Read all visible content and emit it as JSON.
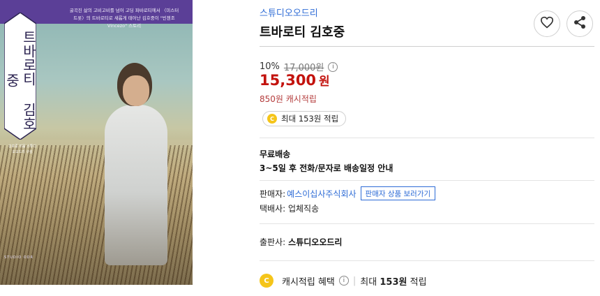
{
  "cover": {
    "title": "트바로티 김호중",
    "blurb": "굴곡진 삶의 고비고비를 넘어 고딩 파바로티에서 〈미스터트롯〉의 트바로티로 새롭게 태어난 김호중이 \"빈첸조Vincezo\" 스토리",
    "credits": "김호중 지음 스튜디오오드리 구성",
    "publisher_mark": "STUDIO ODR"
  },
  "product": {
    "brand": "스튜디오오드리",
    "title": "트바로티 김호중"
  },
  "actions": {
    "like_icon": "heart-icon",
    "share_icon": "share-icon"
  },
  "price": {
    "discount": "10%",
    "original": "17,000원",
    "sale_amount": "15,300",
    "sale_unit": "원",
    "cash_earn": "850원 캐시적립",
    "earn_badge": "최대 153원 적립",
    "coin_letter": "C"
  },
  "shipping": {
    "title": "무료배송",
    "desc": "3~5일 후 전화/문자로 배송일정 안내"
  },
  "seller": {
    "label": "판매자:",
    "name": "예스이십사주식회사",
    "button": "판매자 상품 보러가기",
    "courier": "택배사: 업체직송"
  },
  "publisher": {
    "label": "출판사:",
    "name": "스튜디오오드리"
  },
  "benefit": {
    "label": "캐시적립 혜택",
    "separator": "|",
    "prefix": "최대",
    "amount": "153원",
    "suffix": "적립"
  },
  "colors": {
    "accent_blue": "#2d6bd6",
    "price_red": "#c3130e",
    "coin_yellow": "#f5c51a",
    "cover_purple": "#5b3f97"
  }
}
